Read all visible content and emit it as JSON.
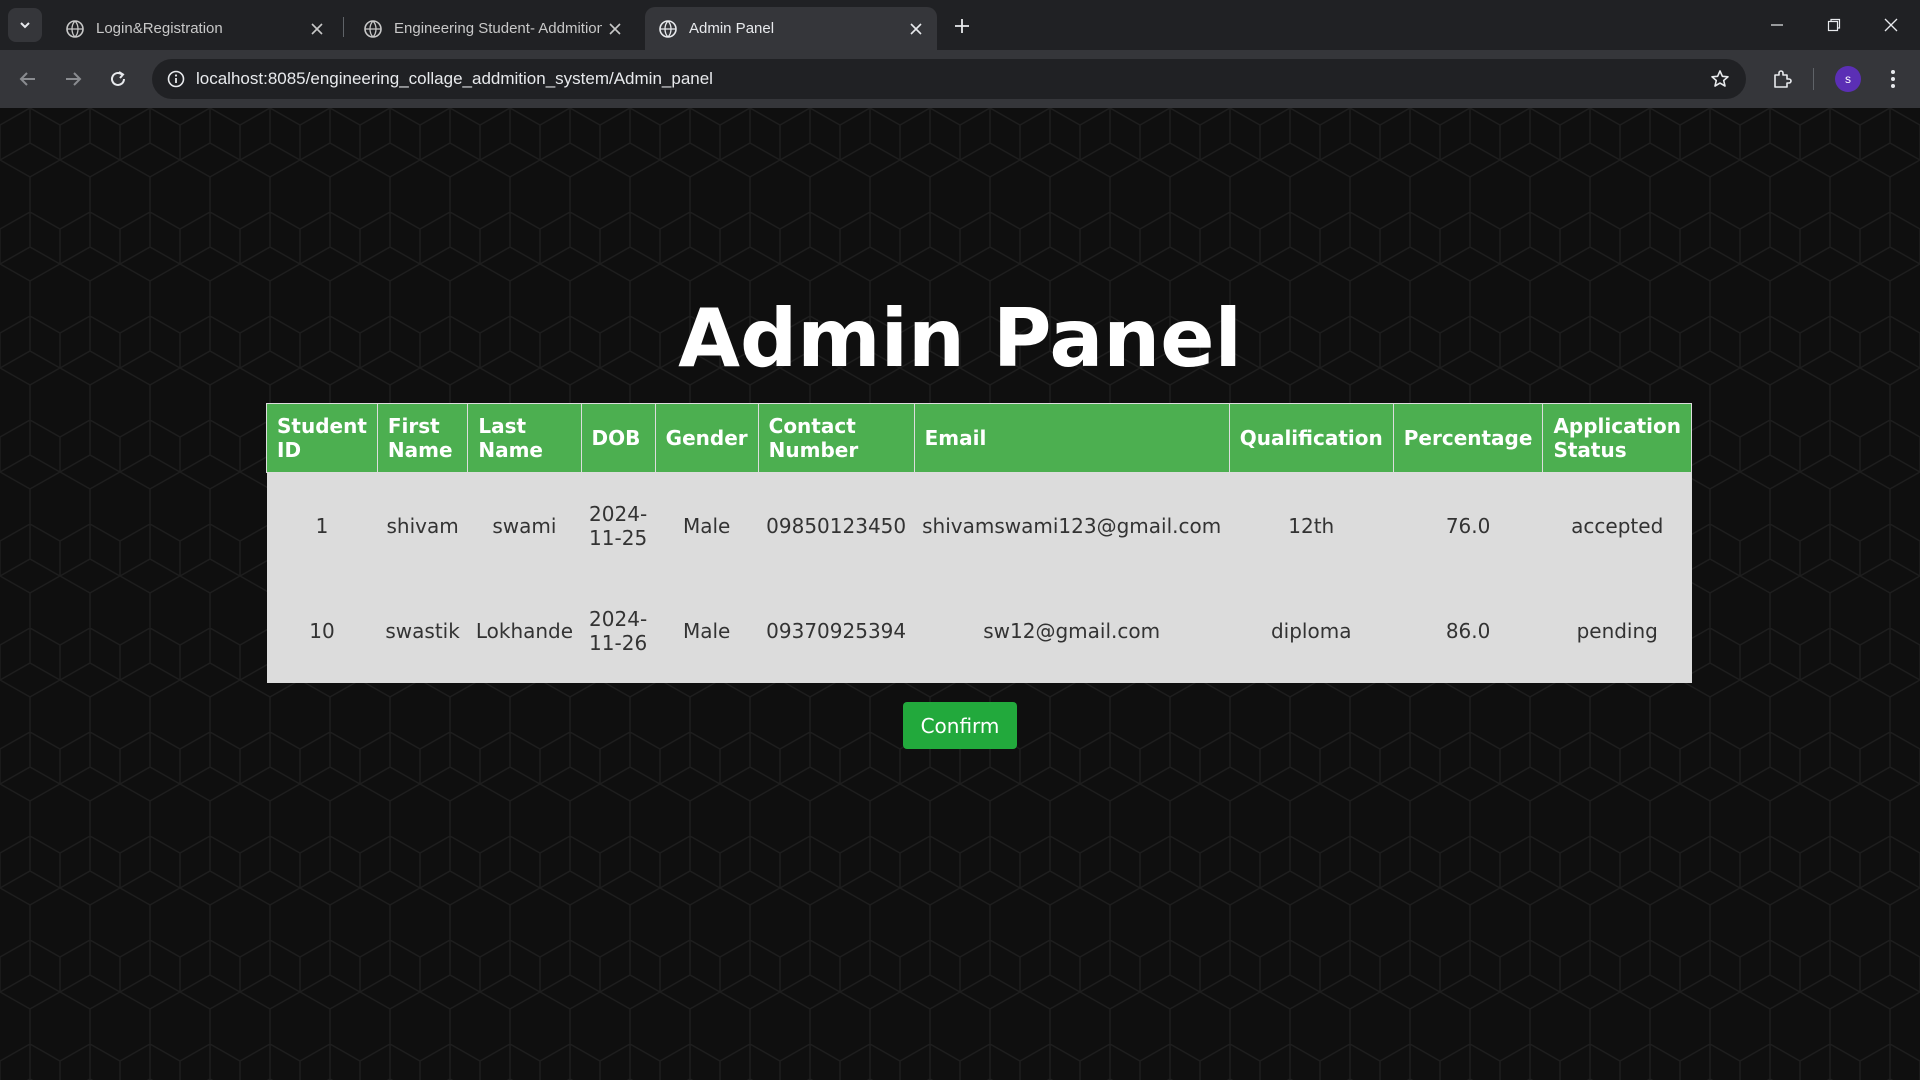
{
  "browser": {
    "tabs": [
      {
        "title": "Login&Registration",
        "active": false
      },
      {
        "title": "Engineering Student- Addmition",
        "active": false
      },
      {
        "title": "Admin Panel",
        "active": true
      }
    ],
    "url": "localhost:8085/engineering_collage_addmition_system/Admin_panel",
    "profile_initial": "s"
  },
  "page": {
    "title": "Admin Panel",
    "table": {
      "headers": [
        "Student ID",
        "First Name",
        "Last Name",
        "DOB",
        "Gender",
        "Contact Number",
        "Email",
        "Qualification",
        "Percentage",
        "Application Status"
      ],
      "rows": [
        [
          "1",
          "shivam",
          "swami",
          "2024-11-25",
          "Male",
          "09850123450",
          "shivamswami123@gmail.com",
          "12th",
          "76.0",
          "accepted"
        ],
        [
          "10",
          "swastik",
          "Lokhande",
          "2024-11-26",
          "Male",
          "09370925394",
          "sw12@gmail.com",
          "diploma",
          "86.0",
          "pending"
        ]
      ]
    },
    "confirm_label": "Confirm"
  },
  "colors": {
    "header_green": "#4caf50",
    "button_green": "#22a93c",
    "row_bg": "#dcdcdc",
    "page_bg": "#0f0f0f"
  }
}
